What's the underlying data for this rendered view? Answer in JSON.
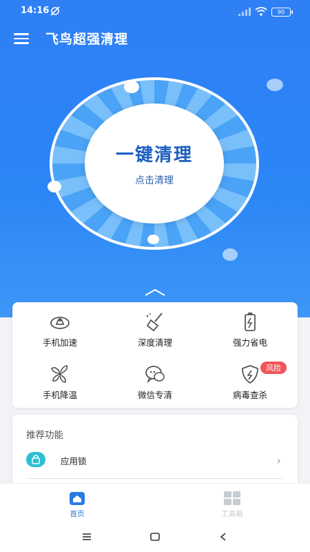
{
  "status": {
    "time": "14:16",
    "battery": "90"
  },
  "header": {
    "title": "飞鸟超强清理"
  },
  "cleaner": {
    "title": "一键清理",
    "subtitle": "点击清理"
  },
  "tools": [
    {
      "label": "手机加速",
      "icon": "rocket-icon"
    },
    {
      "label": "深度清理",
      "icon": "broom-icon"
    },
    {
      "label": "强力省电",
      "icon": "battery-icon"
    },
    {
      "label": "手机降温",
      "icon": "fan-icon"
    },
    {
      "label": "微信专清",
      "icon": "wechat-icon"
    },
    {
      "label": "病毒查杀",
      "icon": "shield-icon",
      "badge": "风险"
    }
  ],
  "recommend": {
    "title": "推荐功能",
    "items": [
      {
        "label": "应用锁",
        "icon": "lock-icon"
      }
    ]
  },
  "bottom_nav": [
    {
      "label": "首页",
      "icon": "home-icon",
      "active": true
    },
    {
      "label": "工具箱",
      "icon": "grid-icon",
      "active": false
    }
  ],
  "colors": {
    "primary": "#2f7ff5",
    "active_nav": "#2a7ae2",
    "inactive_nav": "#c7cbd2",
    "badge": "#f0555a",
    "lock_bg": "#2ac0d4"
  }
}
